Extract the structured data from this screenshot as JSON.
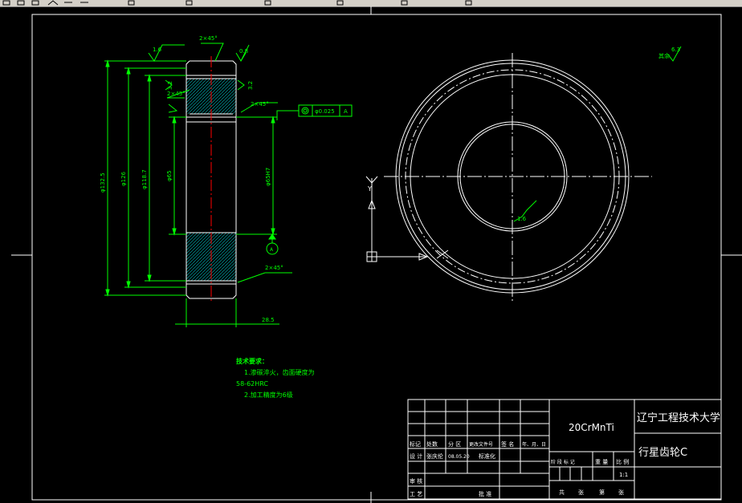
{
  "toolbar": {
    "icons": [
      "new-icon",
      "open-icon",
      "save-icon",
      "print-icon",
      "undo-icon",
      "redo-icon",
      "pan-icon",
      "zoom-icon",
      "layer-icon",
      "properties-icon",
      "match-icon",
      "dimension-icon"
    ]
  },
  "drawing": {
    "colors": {
      "background": "#000000",
      "lines": "#ffffff",
      "dimensions": "#00ff00",
      "centerline": "#ff0000",
      "hatch": "#00c8c8",
      "border": "#ffffff",
      "datum": "#00ff00",
      "cursor": "#ffffff"
    },
    "dimensions": {
      "chamfer_top": "2×45°",
      "chamfer_mid": "2×45°",
      "chamfer_bottom": "2×45°",
      "chamfer_small": "2×45°",
      "rough_top_left": "1.6",
      "rough_top_right": "0.8",
      "rough_small_1": "3.2",
      "rough_small_2": "3.2",
      "dia_outer": "φ132.5",
      "dia_126": "φ126",
      "dia_root": "φ118.7",
      "dia_bore_left": "φ65",
      "dia_bore_right": "φ65H7",
      "width": "28.5",
      "tol_value": "φ0.025",
      "tol_datum": "A",
      "datum_label": "A",
      "other_rough": "其余",
      "other_rough_value": "6.3",
      "roughness_circle": "1.6",
      "datum_y": "Y"
    },
    "notes": {
      "heading": "技术要求：",
      "line1": "1.渗碳淬火，齿面硬度为",
      "line2": "58-62HRC",
      "line3": "2.加工精度为6级"
    },
    "title_block": {
      "material": "20CrMnTi",
      "school": "辽宁工程技术大学",
      "part_name": "行星齿轮C",
      "header_row": [
        "标记",
        "处数",
        "分 区",
        "更改文件号",
        "签 名",
        "年、月、日"
      ],
      "design_row": [
        "设 计",
        "张庆伦",
        "08.05.20",
        "标准化"
      ],
      "stage_labels": [
        "阶 段 标 记",
        "重 量",
        "比 例"
      ],
      "scale": "1:1",
      "review_label": "审 核",
      "process_label": "工 艺",
      "approve_label": "批 准",
      "sheet_text": [
        "共",
        "张",
        "第",
        "张"
      ]
    }
  }
}
